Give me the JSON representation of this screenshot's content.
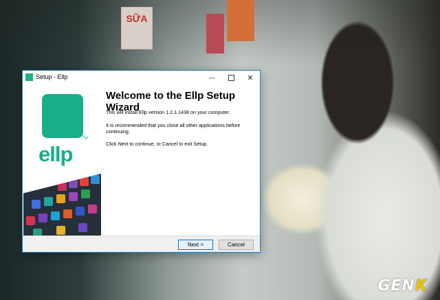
{
  "window": {
    "title": "Setup - Ellp",
    "controls": {
      "minimize": "—",
      "close": "✕"
    }
  },
  "side_panel": {
    "logo_text": "ellp",
    "logo_tm": "TM"
  },
  "content": {
    "heading": "Welcome to the Ellp Setup Wizard",
    "paragraph1": "This will install Ellp version 1.2.1.1438 on your computer.",
    "paragraph2": "It is recommended that you close all other applications before continuing.",
    "paragraph3": "Click Next to continue, or Cancel to exit Setup."
  },
  "buttons": {
    "next": "Next >",
    "cancel": "Cancel"
  },
  "wallpaper": {
    "sign_text": "SỮA",
    "watermark_part1": "GEN",
    "watermark_part2": "K"
  },
  "colors": {
    "brand": "#19ae8a",
    "window_border": "#1f86c7"
  }
}
